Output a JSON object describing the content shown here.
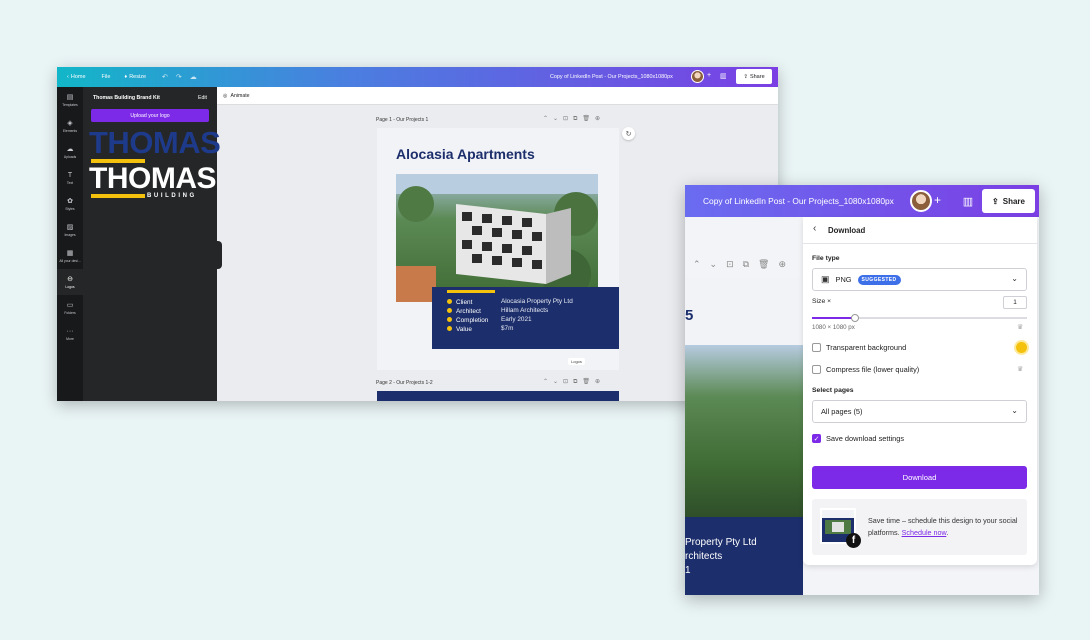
{
  "editor": {
    "topbar": {
      "home": "Home",
      "file": "File",
      "resize": "Resize",
      "title": "Copy of LinkedIn Post - Our Projects_1080x1080px",
      "share": "Share"
    },
    "rail": [
      {
        "icon": "templates-icon",
        "glyph": "▤",
        "label": "Templates"
      },
      {
        "icon": "elements-icon",
        "glyph": "◈",
        "label": "Elements"
      },
      {
        "icon": "uploads-icon",
        "glyph": "☁",
        "label": "Uploads"
      },
      {
        "icon": "text-icon",
        "glyph": "T",
        "label": "Text"
      },
      {
        "icon": "styles-icon",
        "glyph": "✿",
        "label": "Styles"
      },
      {
        "icon": "images-icon",
        "glyph": "▨",
        "label": "Images"
      },
      {
        "icon": "all-your-designs-icon",
        "glyph": "▦",
        "label": "All your desi..."
      },
      {
        "icon": "logos-icon",
        "glyph": "⊖",
        "label": "Logos"
      },
      {
        "icon": "folders-icon",
        "glyph": "▭",
        "label": "Folders"
      },
      {
        "icon": "more-icon",
        "glyph": "···",
        "label": "More"
      }
    ],
    "brand_panel": {
      "title": "Thomas Building Brand Kit",
      "edit": "Edit",
      "upload": "Upload your logo",
      "logo_line1": "THOMAS",
      "logo_line2": "THOMAS",
      "logo_sub": "BUILDING"
    },
    "animate": "Animate",
    "page1": {
      "label": "Page 1 - Our Projects 1",
      "title": "Alocasia Apartments",
      "details": [
        {
          "key": "Client",
          "value": "Alocasia Property Pty Ltd"
        },
        {
          "key": "Architect",
          "value": "Hillam Architects"
        },
        {
          "key": "Completion",
          "value": "Early 2021"
        },
        {
          "key": "Value",
          "value": "$7m"
        }
      ],
      "logo_chip": "Logos"
    },
    "page2": {
      "label": "Page 2 - Our Projects 1-2"
    }
  },
  "download_window": {
    "title": "Copy of LinkedIn Post - Our Projects_1080x1080px",
    "share": "Share",
    "background_heading_fragment": "5",
    "background_rows": [
      "Property Pty Ltd",
      "rchitects",
      "1"
    ],
    "panel": {
      "back": "‹",
      "title": "Download",
      "file_type_label": "File type",
      "file_type_value": "PNG",
      "file_type_badge": "SUGGESTED",
      "size_label": "Size ×",
      "size_value": "1",
      "size_slider_fraction": 0.2,
      "dimensions": "1080 × 1080 px",
      "transparent_bg": "Transparent background",
      "compress": "Compress file (lower quality)",
      "select_pages_label": "Select pages",
      "select_pages_value": "All pages (5)",
      "save_settings": "Save download settings",
      "save_settings_checked": true,
      "download_button": "Download",
      "promo_text": "Save time – schedule this design to your social platforms.",
      "promo_link": "Schedule now",
      "promo_end": "."
    }
  },
  "colors": {
    "brand_purple": "#7d2ae8",
    "navy": "#1c2e6b",
    "yellow": "#f4c20d"
  }
}
